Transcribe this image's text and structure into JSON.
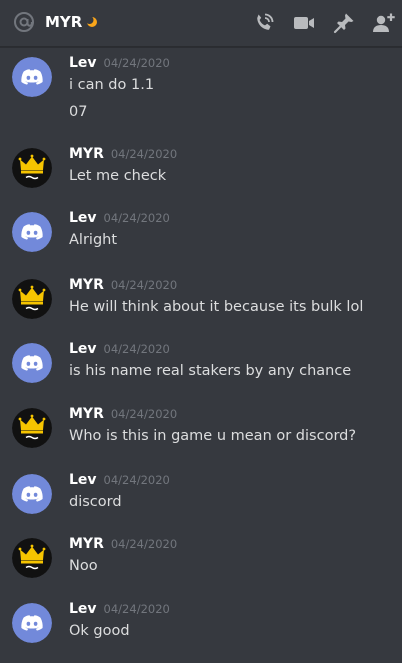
{
  "header": {
    "channel_name": "MYR",
    "at_icon": "at-sign-icon",
    "status_icon": "moon-idle-icon",
    "actions": [
      {
        "name": "start-voice-call-button",
        "icon": "phone-call-icon"
      },
      {
        "name": "start-video-call-button",
        "icon": "video-camera-icon"
      },
      {
        "name": "pinned-messages-button",
        "icon": "pin-icon"
      },
      {
        "name": "add-friends-to-dm-button",
        "icon": "add-user-icon"
      }
    ]
  },
  "colors": {
    "background": "#36393f",
    "discord_blurple": "#7289da",
    "idle_moon": "#faa61a",
    "timestamp": "#72767d"
  },
  "messages": [
    {
      "author": "Lev",
      "timestamp": "04/24/2020",
      "avatar": "discord-default-avatar",
      "lines": [
        "i can do 1.1",
        "07"
      ]
    },
    {
      "author": "MYR",
      "timestamp": "04/24/2020",
      "avatar": "crown-avatar",
      "lines": [
        "Let me check"
      ]
    },
    {
      "author": "Lev",
      "timestamp": "04/24/2020",
      "avatar": "discord-default-avatar",
      "lines": [
        "Alright"
      ]
    },
    {
      "author": "MYR",
      "timestamp": "04/24/2020",
      "avatar": "crown-avatar",
      "lines": [
        "He will think about it because its bulk lol"
      ]
    },
    {
      "author": "Lev",
      "timestamp": "04/24/2020",
      "avatar": "discord-default-avatar",
      "lines": [
        "is his name real stakers by any chance"
      ]
    },
    {
      "author": "MYR",
      "timestamp": "04/24/2020",
      "avatar": "crown-avatar",
      "lines": [
        "Who is this in game u mean or discord?"
      ]
    },
    {
      "author": "Lev",
      "timestamp": "04/24/2020",
      "avatar": "discord-default-avatar",
      "lines": [
        "discord"
      ]
    },
    {
      "author": "MYR",
      "timestamp": "04/24/2020",
      "avatar": "crown-avatar",
      "lines": [
        "Noo"
      ]
    },
    {
      "author": "Lev",
      "timestamp": "04/24/2020",
      "avatar": "discord-default-avatar",
      "lines": [
        "Ok good"
      ]
    }
  ]
}
